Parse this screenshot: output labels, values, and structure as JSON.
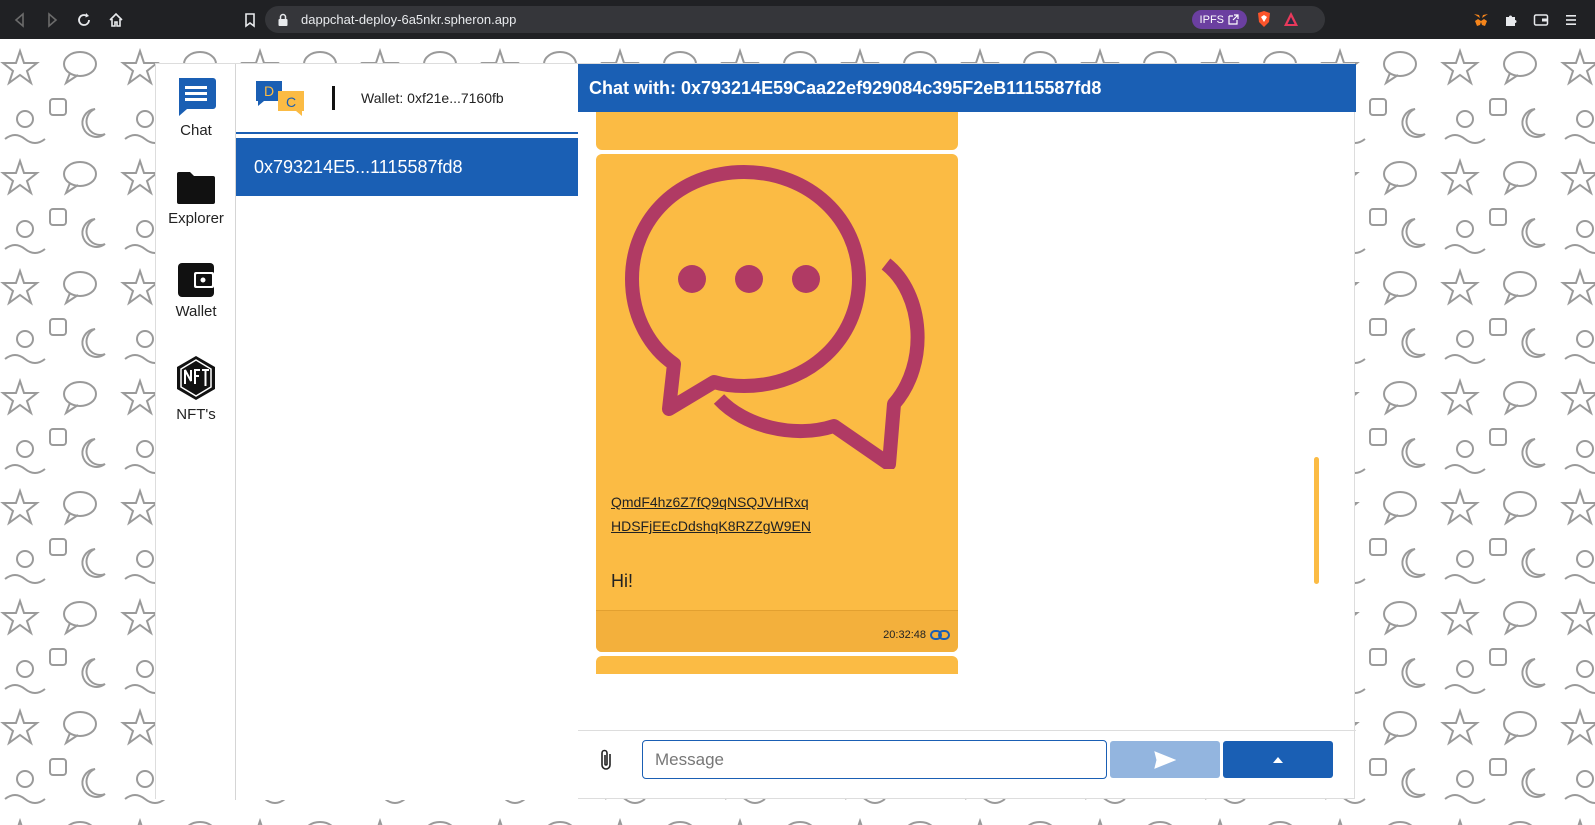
{
  "browser": {
    "url": "dappchat-deploy-6a5nkr.spheron.app",
    "ipfs_label": "IPFS"
  },
  "app": {
    "nav": [
      {
        "label": "Chat",
        "icon": "chat-icon"
      },
      {
        "label": "Explorer",
        "icon": "folder-icon"
      },
      {
        "label": "Wallet",
        "icon": "wallet-icon"
      },
      {
        "label": "NFT's",
        "icon": "nft-icon"
      }
    ],
    "logo_letters": {
      "d": "D",
      "c": "C"
    },
    "wallet_label": "Wallet: 0xf21e...7160fb",
    "contacts": [
      {
        "label": "0x793214E5...1115587fd8"
      }
    ],
    "chat_header": "Chat with: 0x793214E59Caa22ef929084c395F2eB1115587fd8",
    "message": {
      "cid_line1": "QmdF4hz6Z7fQ9qNSQJVHRxq",
      "cid_line2": "HDSFjEEcDdshqK8RZZgW9EN",
      "text": "Hi!",
      "time": "20:32:48"
    },
    "composer": {
      "placeholder": "Message"
    }
  },
  "colors": {
    "primary": "#1a5fb4",
    "message_bg": "#fbbb44",
    "chat_icon": "#b03a64"
  }
}
